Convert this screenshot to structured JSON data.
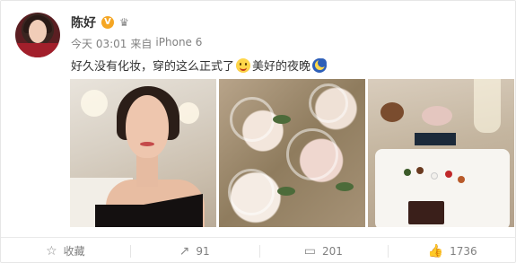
{
  "post": {
    "author": "陈好",
    "badge_vip": "V",
    "badge_member": "♛",
    "time": "今天 03:01",
    "source_prefix": "来自",
    "source": "iPhone 6",
    "text_part1": "好久没有化妆，穿的这么正式了",
    "text_part2": "美好的夜晚",
    "icons": [
      "vip-icon",
      "crown-icon",
      "smile-icon",
      "moon-icon",
      "star-icon",
      "share-icon",
      "comment-icon",
      "like-icon"
    ]
  },
  "photos": [
    {
      "alt": "woman-selfie"
    },
    {
      "alt": "roses-centerpiece"
    },
    {
      "alt": "dessert-plate"
    }
  ],
  "actions": {
    "favorite_label": "收藏",
    "share_count": "91",
    "comment_count": "201",
    "like_count": "1736"
  },
  "colors": {
    "accent_vip": "#f5a623",
    "text_primary": "#333333",
    "text_secondary": "#808080"
  }
}
